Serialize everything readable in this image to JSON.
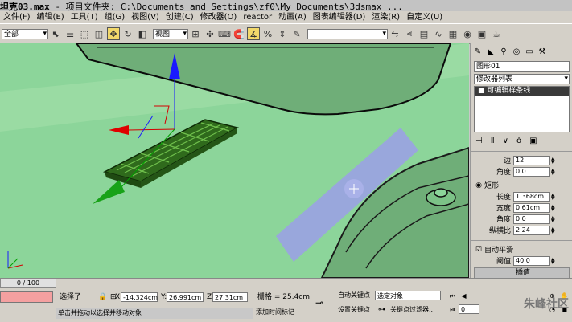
{
  "window": {
    "title": "坦克03.max",
    "subtitle": "- 项目文件夹: C:\\Documents and Settings\\zf0\\My Documents\\3dsmax ..."
  },
  "menu": [
    "文件(F)",
    "编辑(E)",
    "工具(T)",
    "组(G)",
    "视图(V)",
    "创建(C)",
    "修改器(O)",
    "reactor",
    "动画(A)",
    "图表编辑器(D)",
    "渲染(R)",
    "自定义(U)"
  ],
  "toolbar": {
    "selection_filter": "全部",
    "coord_system": "视图"
  },
  "panel": {
    "object_name": "图形01",
    "modifier_list": "修改器列表",
    "stack_item": "可编辑样条线",
    "edge_label": "边",
    "edge_value": "12",
    "angle1_label": "角度",
    "angle1_value": "0.0",
    "rect_label": "矩形",
    "length_label": "长度",
    "length_value": "1.368cm",
    "width_label": "宽度",
    "width_value": "0.61cm",
    "angle2_label": "角度",
    "angle2_value": "0.0",
    "aspect_label": "纵横比",
    "aspect_value": "2.24",
    "auto_smooth_label": "自动平滑",
    "threshold_label": "阈值",
    "threshold_value": "40.0",
    "interp_label": "插值"
  },
  "status": {
    "frame": "0 / 100",
    "selected": "选择了",
    "x_label": "X:",
    "x_value": "-14.324cm",
    "y_label": "Y:",
    "y_value": "26.991cm",
    "z_label": "Z:",
    "z_value": "27.31cm",
    "grid": "栅格 = 25.4cm",
    "auto_key": "自动关键点",
    "set_key": "设置关键点",
    "selected_obj": "选定对象",
    "key_filter": "关键点过滤器...",
    "add_time_tag": "添加时间标记",
    "prompt": "单击并拖动以选择并移动对象",
    "frame_field": "0"
  },
  "watermark": "朱峰社区"
}
